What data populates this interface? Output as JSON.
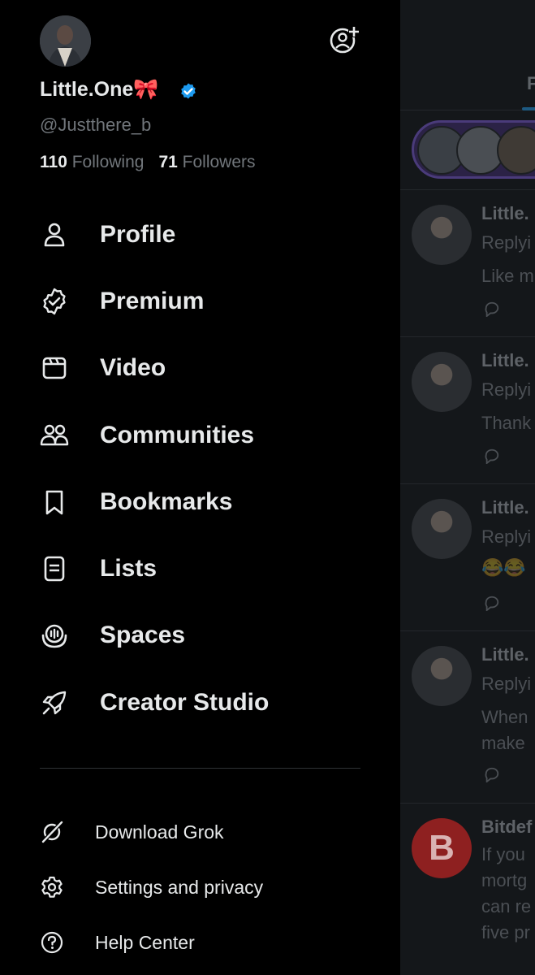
{
  "profile": {
    "display_name": "Little.One🎀",
    "handle": "@Justthere_b",
    "following_count": "110",
    "following_label": "Following",
    "followers_count": "71",
    "followers_label": "Followers"
  },
  "menu": {
    "items": [
      {
        "label": "Profile",
        "icon": "person-icon"
      },
      {
        "label": "Premium",
        "icon": "premium-badge-icon"
      },
      {
        "label": "Video",
        "icon": "video-icon"
      },
      {
        "label": "Communities",
        "icon": "communities-icon"
      },
      {
        "label": "Bookmarks",
        "icon": "bookmark-icon"
      },
      {
        "label": "Lists",
        "icon": "list-icon"
      },
      {
        "label": "Spaces",
        "icon": "spaces-icon"
      },
      {
        "label": "Creator Studio",
        "icon": "rocket-icon"
      }
    ],
    "secondary": [
      {
        "label": "Download Grok",
        "icon": "grok-icon"
      },
      {
        "label": "Settings and privacy",
        "icon": "gear-icon"
      },
      {
        "label": "Help Center",
        "icon": "help-icon"
      }
    ]
  },
  "timeline": {
    "tab_fragment": "F",
    "posts": [
      {
        "name": "Little.",
        "line1": "Replyi",
        "line2": "Like m",
        "line3": ""
      },
      {
        "name": "Little.",
        "line1": "Replyi",
        "line2": "Thank",
        "line3": ""
      },
      {
        "name": "Little.",
        "line1": "Replyi",
        "line2": "😂😂",
        "line3": ""
      },
      {
        "name": "Little.",
        "line1": "Replyi",
        "line2": "When",
        "line3": "make"
      },
      {
        "name": "Bitdef",
        "line1": "If you",
        "line2": "mortg",
        "line3": "can re",
        "line4": "five pr",
        "avatar_letter": "B"
      }
    ]
  },
  "colors": {
    "background": "#000000",
    "text_primary": "#e7e9ea",
    "text_secondary": "#71767b",
    "verified_blue": "#1d9bf0",
    "divider": "#2f3336"
  }
}
